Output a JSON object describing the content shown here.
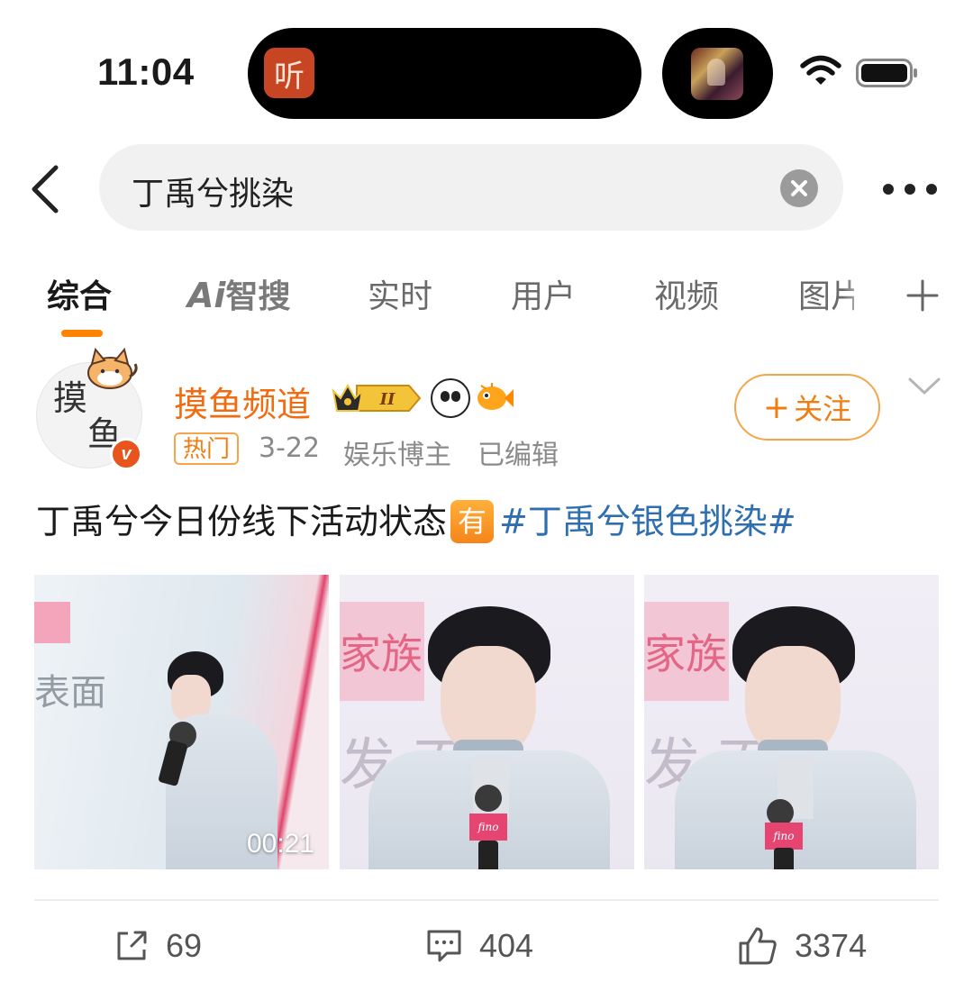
{
  "status_bar": {
    "time": "11:04",
    "island_app_glyph": "听",
    "icons": [
      "wifi-icon",
      "battery-icon"
    ]
  },
  "search": {
    "query": "丁禹兮挑染"
  },
  "tabs": [
    {
      "label": "综合",
      "active": true
    },
    {
      "label_ai": "Ai",
      "label": "智搜",
      "active": false
    },
    {
      "label": "实时",
      "active": false
    },
    {
      "label": "用户",
      "active": false
    },
    {
      "label": "视频",
      "active": false
    },
    {
      "label": "图片",
      "active": false
    }
  ],
  "post": {
    "author": {
      "name": "摸鱼频道",
      "avatar_glyphs": [
        "摸",
        "鱼"
      ],
      "level_badge": "II",
      "verified_mark": "v"
    },
    "meta": {
      "tag": "热门",
      "date": "3-22",
      "role": "娱乐博主",
      "edited": "已编辑"
    },
    "follow_label": "关注",
    "text": {
      "main": "丁禹兮今日份线下活动状态",
      "badge": "有",
      "hashtag": "#丁禹兮银色挑染#"
    },
    "media": [
      {
        "type": "video",
        "duration": "00:21",
        "bg_text": "表面"
      },
      {
        "type": "image",
        "bg_text": "家族",
        "bg_big": "发 面",
        "mic_brand": "fino"
      },
      {
        "type": "image",
        "bg_text": "家族",
        "bg_big": "发 面",
        "mic_brand": "fino"
      }
    ],
    "actions": {
      "reposts": "69",
      "comments": "404",
      "likes": "3374"
    }
  },
  "colors": {
    "accent_orange": "#ff8200",
    "author_orange": "#f26b10",
    "hashtag_blue": "#2f6fb0"
  }
}
